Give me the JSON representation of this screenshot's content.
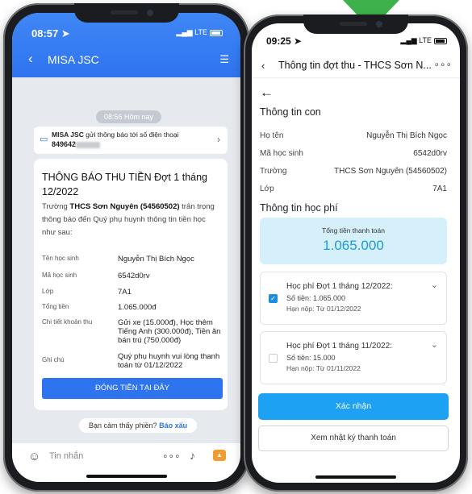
{
  "left_phone": {
    "status_time": "08:57",
    "status_network": "LTE",
    "header_title": "MISA JSC",
    "time_chip": "08:56 Hôm nay",
    "notice": {
      "sender": "MISA JSC",
      "text": "gửi thông báo tới số điện thoại",
      "phone": "849642"
    },
    "message": {
      "title": "THÔNG BÁO THU TIỀN Đợt 1 tháng 12/2022",
      "intro_prefix": "Trường ",
      "intro_school": "THCS Sơn Nguyên (54560502)",
      "intro_suffix": " trân trọng thông báo đến Quý phụ huynh thông tin tiền học như sau:",
      "rows": [
        {
          "label": "Tên học sinh",
          "value": "Nguyễn Thị Bích Ngọc"
        },
        {
          "label": "Mã học sinh",
          "value": "6542d0rv"
        },
        {
          "label": "Lớp",
          "value": "7A1"
        },
        {
          "label": "Tổng tiền",
          "value": "1.065.000đ"
        },
        {
          "label": "Chi tiết khoản thu",
          "value": "Gửi xe (15.000đ), Học thêm Tiếng Anh (300.000đ), Tiền ăn bán trú (750.000đ)"
        },
        {
          "label": "Ghi chú",
          "value": "Quý phụ huynh vui lòng thanh toán từ 01/12/2022"
        }
      ],
      "pay_button": "ĐÓNG TIỀN TẠI ĐÂY"
    },
    "feedback_text": "Bạn cảm thấy phiền?",
    "feedback_link": "Báo xấu",
    "input_placeholder": "Tin nhắn"
  },
  "right_phone": {
    "status_time": "09:25",
    "status_network": "LTE",
    "nav_title": "Thông tin đợt thu - THCS Sơn N...",
    "section_student": "Thông tin con",
    "student_rows": [
      {
        "label": "Họ tên",
        "value": "Nguyễn Thị Bích Ngọc"
      },
      {
        "label": "Mã học sinh",
        "value": "6542d0rv"
      },
      {
        "label": "Trường",
        "value": "THCS Sơn Nguyên (54560502)"
      },
      {
        "label": "Lớp",
        "value": "7A1"
      }
    ],
    "section_fee": "Thông tin học phí",
    "total_label": "Tổng tiền thanh toán",
    "total_value": "1.065.000",
    "fees": [
      {
        "title": "Học phí Đợt 1 tháng 12/2022:",
        "amount": "Số tiền: 1.065.000",
        "due": "Hạn nộp: Từ 01/12/2022",
        "checked": true
      },
      {
        "title": "Học phí Đợt 1 tháng 11/2022:",
        "amount": "Số tiền: 15.000",
        "due": "Hạn nộp: Từ 01/11/2022",
        "checked": false
      }
    ],
    "confirm_button": "Xác nhận",
    "history_button": "Xem nhật ký thanh toán"
  },
  "colors": {
    "zalo_blue": "#2f74ef",
    "accent_blue": "#1da1f2",
    "total_bg": "#d5f0fb",
    "total_text": "#1a9cd8",
    "deco_green": "#3eb24a"
  }
}
